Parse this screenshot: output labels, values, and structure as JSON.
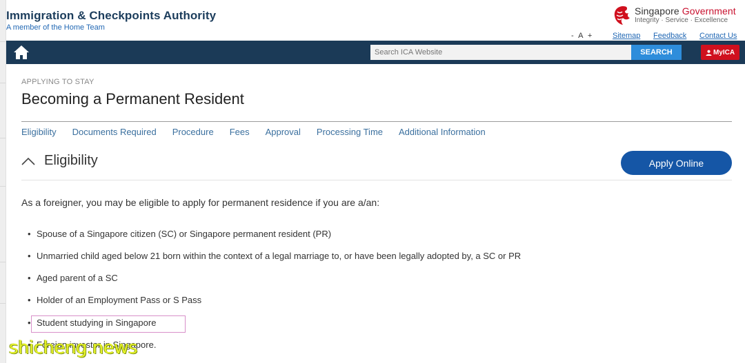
{
  "header": {
    "agency_name": "Immigration & Checkpoints Authority",
    "agency_sub": "A member of the Home Team",
    "gov_title_1": "Singapore",
    "gov_title_2": "Government",
    "gov_tagline": "Integrity · Service · Excellence",
    "font_controls": "- A +",
    "links": [
      "Sitemap",
      "Feedback",
      "Contact Us"
    ]
  },
  "nav": {
    "search_placeholder": "Search ICA Website",
    "search_label": "SEARCH",
    "myica_label": "MyICA"
  },
  "page": {
    "breadcrumb": "APPLYING TO STAY",
    "title": "Becoming a Permanent Resident",
    "tabs": [
      "Eligibility",
      "Documents Required",
      "Procedure",
      "Fees",
      "Approval",
      "Processing Time",
      "Additional Information"
    ]
  },
  "section": {
    "title": "Eligibility",
    "apply_label": "Apply Online",
    "intro": "As a foreigner, you may be eligible to apply for permanent residence if you are a/an:",
    "items": [
      "Spouse of a Singapore citizen (SC) or Singapore permanent resident (PR)",
      "Unmarried child aged below 21 born within the context of a legal marriage to, or have been legally adopted by, a SC or PR",
      "Aged parent of a SC",
      "Holder of an Employment Pass or S Pass",
      "Student studying in Singapore",
      "Foreign investor in Singapore."
    ]
  },
  "watermark": "shicheng.news",
  "colors": {
    "navbar": "#1b3a57",
    "search_button": "#2e8ddb",
    "myica": "#d0101e",
    "apply_button": "#1556a6",
    "highlight_border": "#d88fc9",
    "link": "#3a6f9e"
  }
}
